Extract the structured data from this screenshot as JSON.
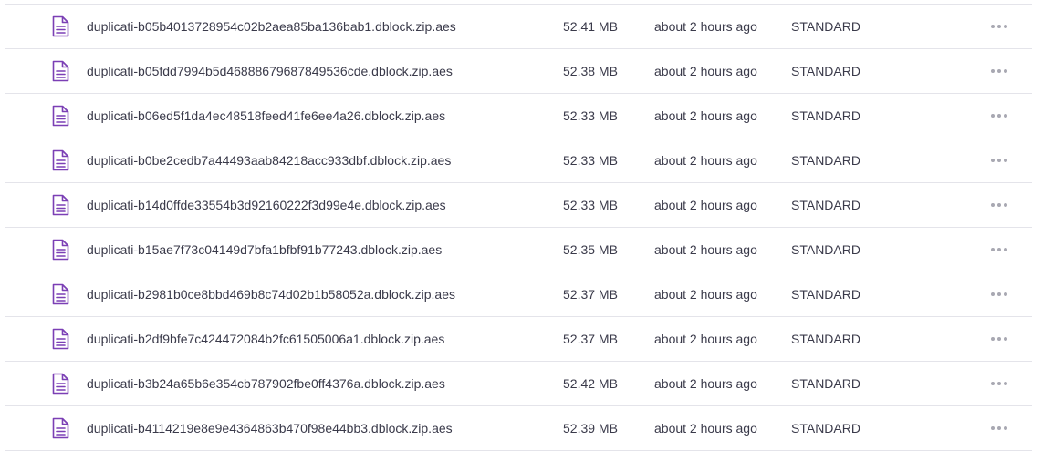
{
  "theme": {
    "icon_color": "#7b3fb5",
    "text_color": "#3a3a4a",
    "divider_color": "#e4e4ea",
    "more_dots_color": "#a8a8b2"
  },
  "file_icon_name": "document-icon",
  "more_icon_name": "more-horizontal-icon",
  "files": [
    {
      "name": "duplicati-b05b4013728954c02b2aea85ba136bab1.dblock.zip.aes",
      "size": "52.41 MB",
      "modified": "about 2 hours ago",
      "storage_class": "STANDARD"
    },
    {
      "name": "duplicati-b05fdd7994b5d46888679687849536cde.dblock.zip.aes",
      "size": "52.38 MB",
      "modified": "about 2 hours ago",
      "storage_class": "STANDARD"
    },
    {
      "name": "duplicati-b06ed5f1da4ec48518feed41fe6ee4a26.dblock.zip.aes",
      "size": "52.33 MB",
      "modified": "about 2 hours ago",
      "storage_class": "STANDARD"
    },
    {
      "name": "duplicati-b0be2cedb7a44493aab84218acc933dbf.dblock.zip.aes",
      "size": "52.33 MB",
      "modified": "about 2 hours ago",
      "storage_class": "STANDARD"
    },
    {
      "name": "duplicati-b14d0ffde33554b3d92160222f3d99e4e.dblock.zip.aes",
      "size": "52.33 MB",
      "modified": "about 2 hours ago",
      "storage_class": "STANDARD"
    },
    {
      "name": "duplicati-b15ae7f73c04149d7bfa1bfbf91b77243.dblock.zip.aes",
      "size": "52.35 MB",
      "modified": "about 2 hours ago",
      "storage_class": "STANDARD"
    },
    {
      "name": "duplicati-b2981b0ce8bbd469b8c74d02b1b58052a.dblock.zip.aes",
      "size": "52.37 MB",
      "modified": "about 2 hours ago",
      "storage_class": "STANDARD"
    },
    {
      "name": "duplicati-b2df9bfe7c424472084b2fc61505006a1.dblock.zip.aes",
      "size": "52.37 MB",
      "modified": "about 2 hours ago",
      "storage_class": "STANDARD"
    },
    {
      "name": "duplicati-b3b24a65b6e354cb787902fbe0ff4376a.dblock.zip.aes",
      "size": "52.42 MB",
      "modified": "about 2 hours ago",
      "storage_class": "STANDARD"
    },
    {
      "name": "duplicati-b4114219e8e9e4364863b470f98e44bb3.dblock.zip.aes",
      "size": "52.39 MB",
      "modified": "about 2 hours ago",
      "storage_class": "STANDARD"
    }
  ]
}
